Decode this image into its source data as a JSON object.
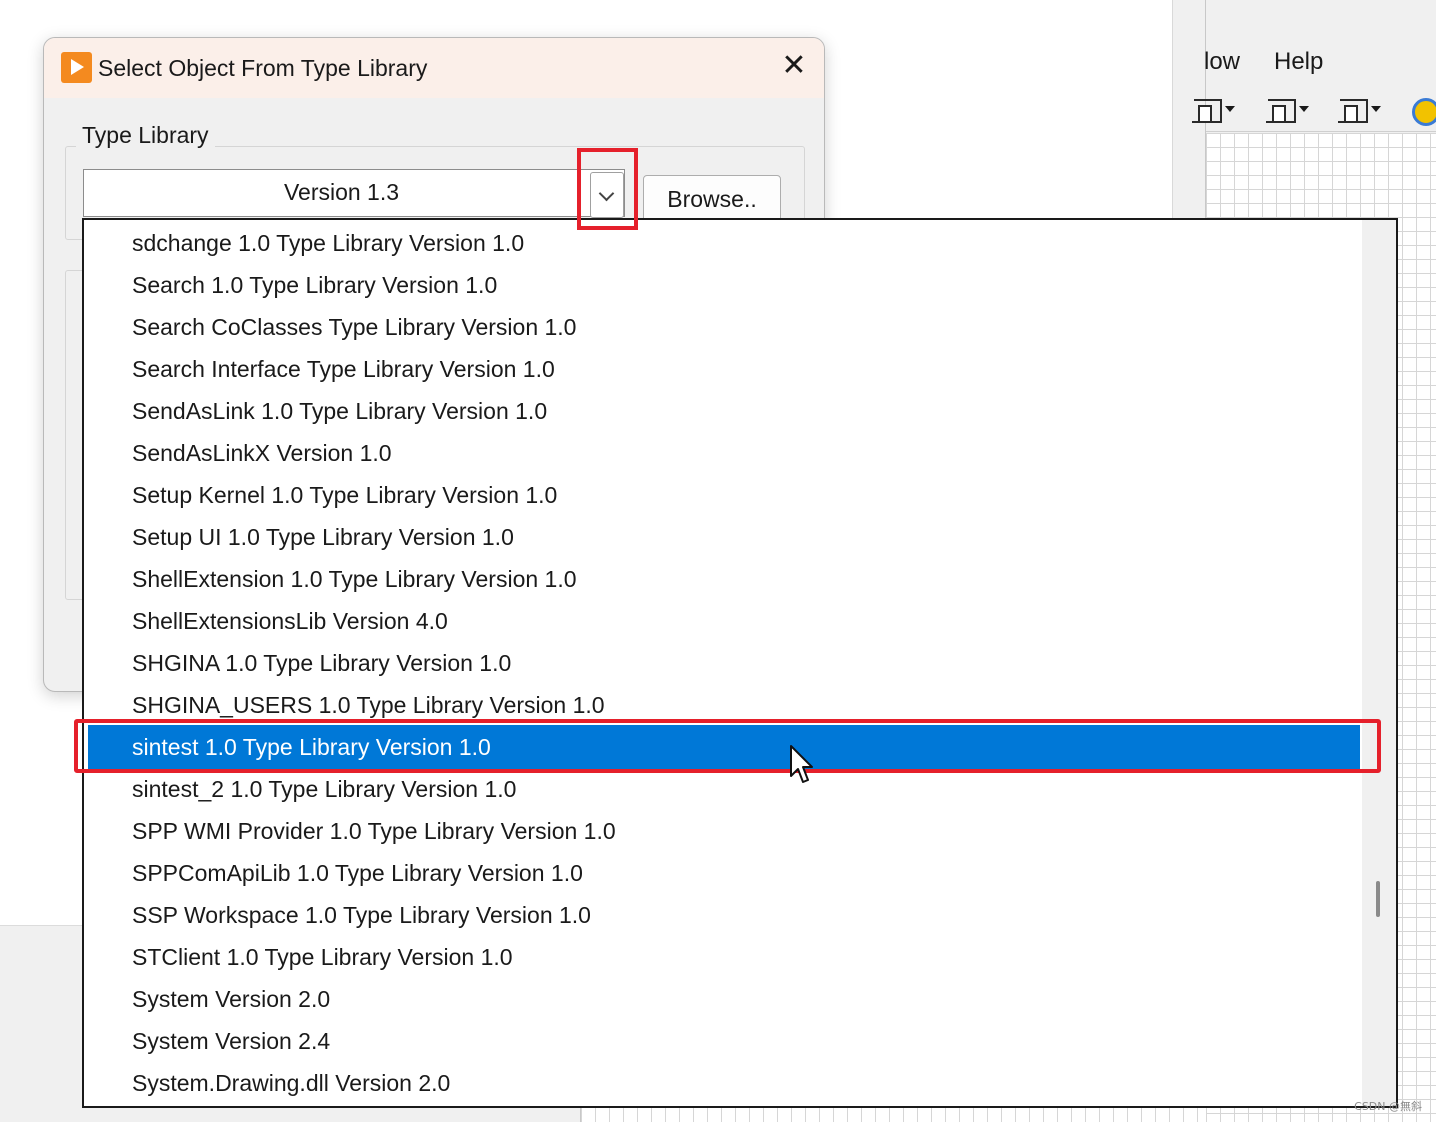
{
  "background_app": {
    "menu": [
      "low",
      "Help"
    ]
  },
  "dialog": {
    "title": "Select Object From Type Library",
    "close_glyph": "✕",
    "group_label": "Type Library",
    "combo_value": "Version 1.3",
    "browse_label": "Browse.."
  },
  "dropdown": {
    "items": [
      "sdchange 1.0 Type Library Version 1.0",
      "Search 1.0 Type Library Version 1.0",
      "Search CoClasses Type Library Version 1.0",
      "Search Interface Type Library Version 1.0",
      "SendAsLink 1.0 Type Library Version 1.0",
      "SendAsLinkX Version 1.0",
      "Setup Kernel 1.0 Type Library Version 1.0",
      "Setup UI 1.0 Type Library Version 1.0",
      "ShellExtension 1.0 Type Library Version 1.0",
      "ShellExtensionsLib Version 4.0",
      "SHGINA 1.0 Type Library Version 1.0",
      "SHGINA_USERS 1.0 Type Library Version 1.0",
      "sintest 1.0 Type Library Version 1.0",
      "sintest_2 1.0 Type Library Version 1.0",
      "SPP WMI Provider 1.0 Type Library Version 1.0",
      "SPPComApiLib 1.0 Type Library Version 1.0",
      "SSP Workspace 1.0 Type Library Version 1.0",
      "STClient 1.0 Type Library Version 1.0",
      "System Version 2.0",
      "System Version 2.4",
      "System.Drawing.dll Version 2.0"
    ],
    "selected_index": 12
  },
  "colors": {
    "selection": "#0078d7",
    "annotation": "#e5202b",
    "app_icon": "#f48a1f"
  },
  "icons": {
    "app": "labview-run-arrow-icon",
    "dropdown": "chevron-down-icon",
    "cursor": "mouse-pointer-icon"
  },
  "watermark": "CSDN @無斜"
}
